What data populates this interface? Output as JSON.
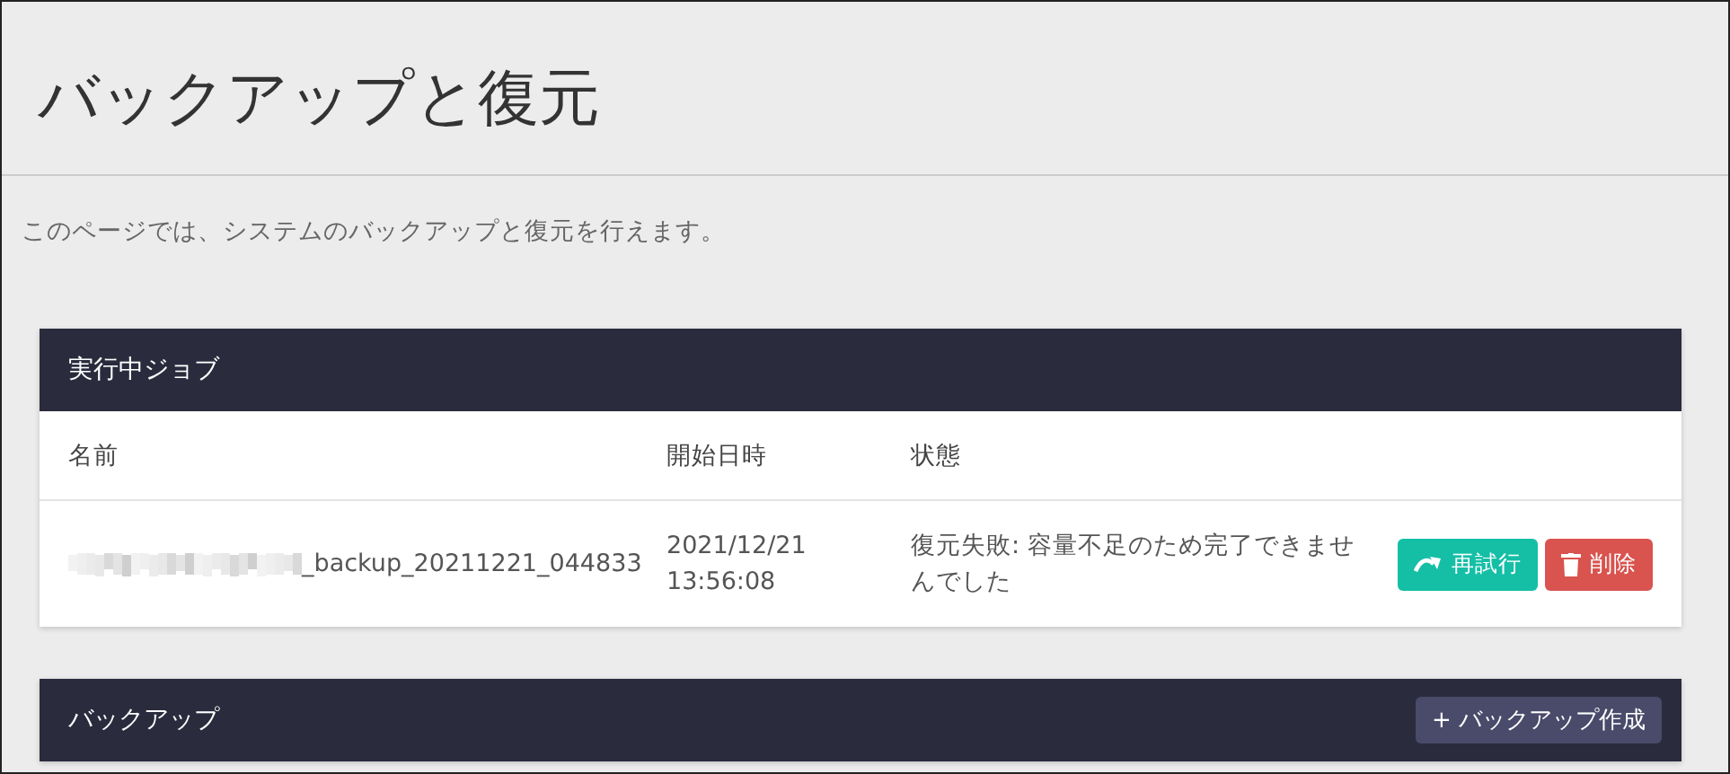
{
  "page": {
    "title": "バックアップと復元",
    "description": "このページでは、システムのバックアップと復元を行えます。"
  },
  "running_jobs": {
    "title": "実行中ジョブ",
    "columns": [
      "名前",
      "開始日時",
      "状態"
    ],
    "rows": [
      {
        "name": "_backup_20211221_044833",
        "name_redacted": true,
        "started": [
          "2021/12/21",
          "13:56:08"
        ],
        "status": "復元失敗: 容量不足のため完了できませんでした",
        "actions": [
          {
            "kind": "retry",
            "label": "再試行"
          },
          {
            "kind": "delete",
            "label": "削除"
          }
        ]
      }
    ]
  },
  "backups": {
    "title": "バックアップ",
    "create_button": "+ バックアップ作成"
  }
}
